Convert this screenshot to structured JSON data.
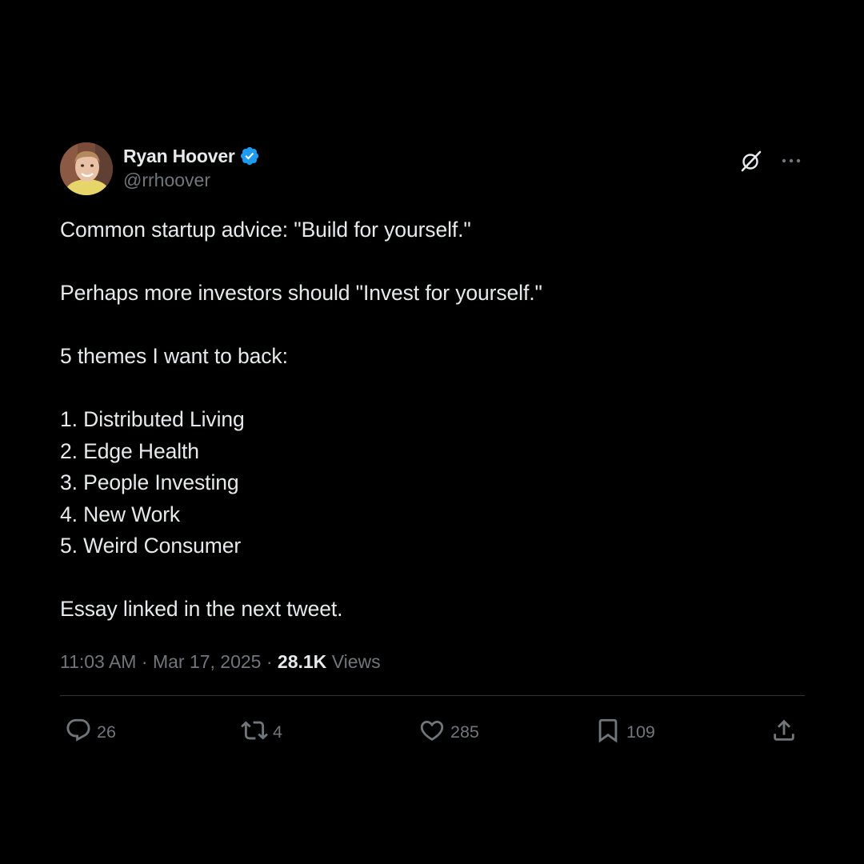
{
  "author": {
    "display_name": "Ryan Hoover",
    "handle": "@rrhoover",
    "verified": true,
    "verified_color": "#1d9bf0"
  },
  "icons": {
    "avatar": "avatar",
    "verified": "verified-badge-icon",
    "grok": "grok-icon",
    "more": "more-options-icon",
    "reply": "reply-icon",
    "retweet": "retweet-icon",
    "like": "heart-icon",
    "bookmark": "bookmark-icon",
    "share": "share-icon"
  },
  "body": {
    "line1": "Common startup advice: \"Build for yourself.\"",
    "line2": "Perhaps more investors should \"Invest for yourself.\"",
    "line3": "5 themes I want to back:",
    "list": [
      "1. Distributed Living",
      "2. Edge Health",
      "3. People Investing",
      "4. New Work",
      "5. Weird Consumer"
    ],
    "line4": "Essay linked in the next tweet."
  },
  "meta": {
    "time": "11:03 AM",
    "separator": "·",
    "date": "Mar 17, 2025",
    "views_count": "28.1K",
    "views_label": "Views"
  },
  "actions": {
    "replies": "26",
    "retweets": "4",
    "likes": "285",
    "bookmarks": "109"
  },
  "colors": {
    "background": "#000000",
    "text": "#e7e9ea",
    "muted": "#71767b",
    "divider": "#2f3336",
    "accent": "#1d9bf0"
  }
}
